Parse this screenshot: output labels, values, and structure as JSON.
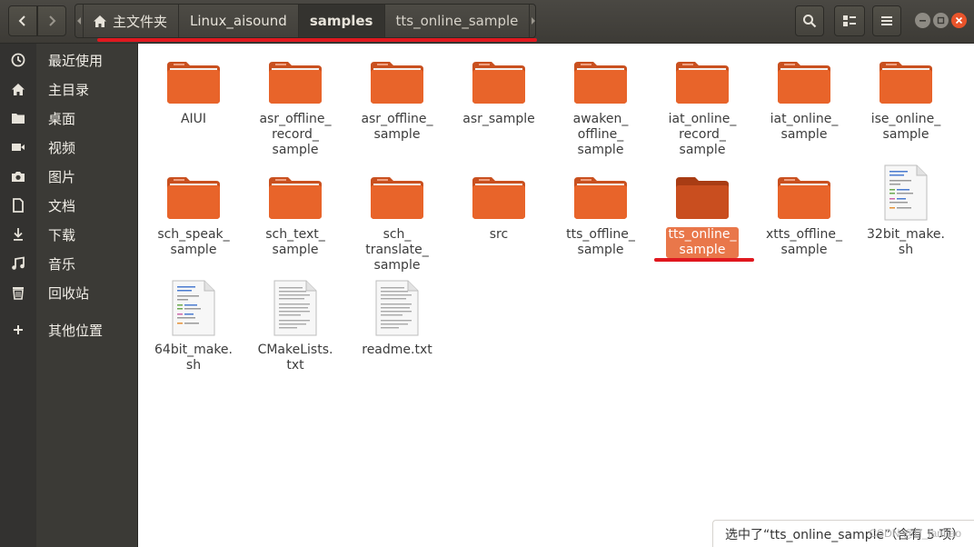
{
  "header": {
    "path": [
      "主文件夹",
      "Linux_aisound",
      "samples",
      "tts_online_sample"
    ],
    "active_index": 2,
    "icons": {
      "back": "chevron-left-icon",
      "forward": "chevron-right-icon",
      "home": "home-icon",
      "search": "search-icon",
      "view": "view-options-icon",
      "menu": "hamburger-menu-icon"
    }
  },
  "sidebar": {
    "items": [
      {
        "label": "最近使用",
        "icon": "recent-icon"
      },
      {
        "label": "主目录",
        "icon": "home-icon"
      },
      {
        "label": "桌面",
        "icon": "folder-icon"
      },
      {
        "label": "视频",
        "icon": "video-icon"
      },
      {
        "label": "图片",
        "icon": "camera-icon"
      },
      {
        "label": "文档",
        "icon": "document-icon"
      },
      {
        "label": "下载",
        "icon": "download-icon"
      },
      {
        "label": "音乐",
        "icon": "music-icon"
      },
      {
        "label": "回收站",
        "icon": "trash-icon"
      },
      {
        "label": "其他位置",
        "icon": "plus-icon"
      }
    ]
  },
  "files": [
    {
      "name": "AIUI",
      "type": "folder"
    },
    {
      "name": "asr_offline_\nrecord_\nsample",
      "type": "folder"
    },
    {
      "name": "asr_offline_\nsample",
      "type": "folder"
    },
    {
      "name": "asr_sample",
      "type": "folder"
    },
    {
      "name": "awaken_\noffline_\nsample",
      "type": "folder"
    },
    {
      "name": "iat_online_\nrecord_\nsample",
      "type": "folder"
    },
    {
      "name": "iat_online_\nsample",
      "type": "folder"
    },
    {
      "name": "ise_online_\nsample",
      "type": "folder"
    },
    {
      "name": "sch_speak_\nsample",
      "type": "folder"
    },
    {
      "name": "sch_text_\nsample",
      "type": "folder"
    },
    {
      "name": "sch_\ntranslate_\nsample",
      "type": "folder"
    },
    {
      "name": "src",
      "type": "folder"
    },
    {
      "name": "tts_offline_\nsample",
      "type": "folder"
    },
    {
      "name": "tts_online_\nsample",
      "type": "folder",
      "selected": true
    },
    {
      "name": "xtts_offline_\nsample",
      "type": "folder"
    },
    {
      "name": "32bit_make.\nsh",
      "type": "script"
    },
    {
      "name": "64bit_make.\nsh",
      "type": "script"
    },
    {
      "name": "CMakeLists.\ntxt",
      "type": "text"
    },
    {
      "name": "readme.txt",
      "type": "text"
    }
  ],
  "status": {
    "text": "选中了“tts_online_sample”（含有 5 项）",
    "watermark": "CSDN @H_fanhao"
  },
  "colors": {
    "folder": "#e8642a",
    "folder_selected": "#c94e1f",
    "selection": "#e9774a",
    "annotation": "#e0181f",
    "close_button": "#e9542b"
  }
}
